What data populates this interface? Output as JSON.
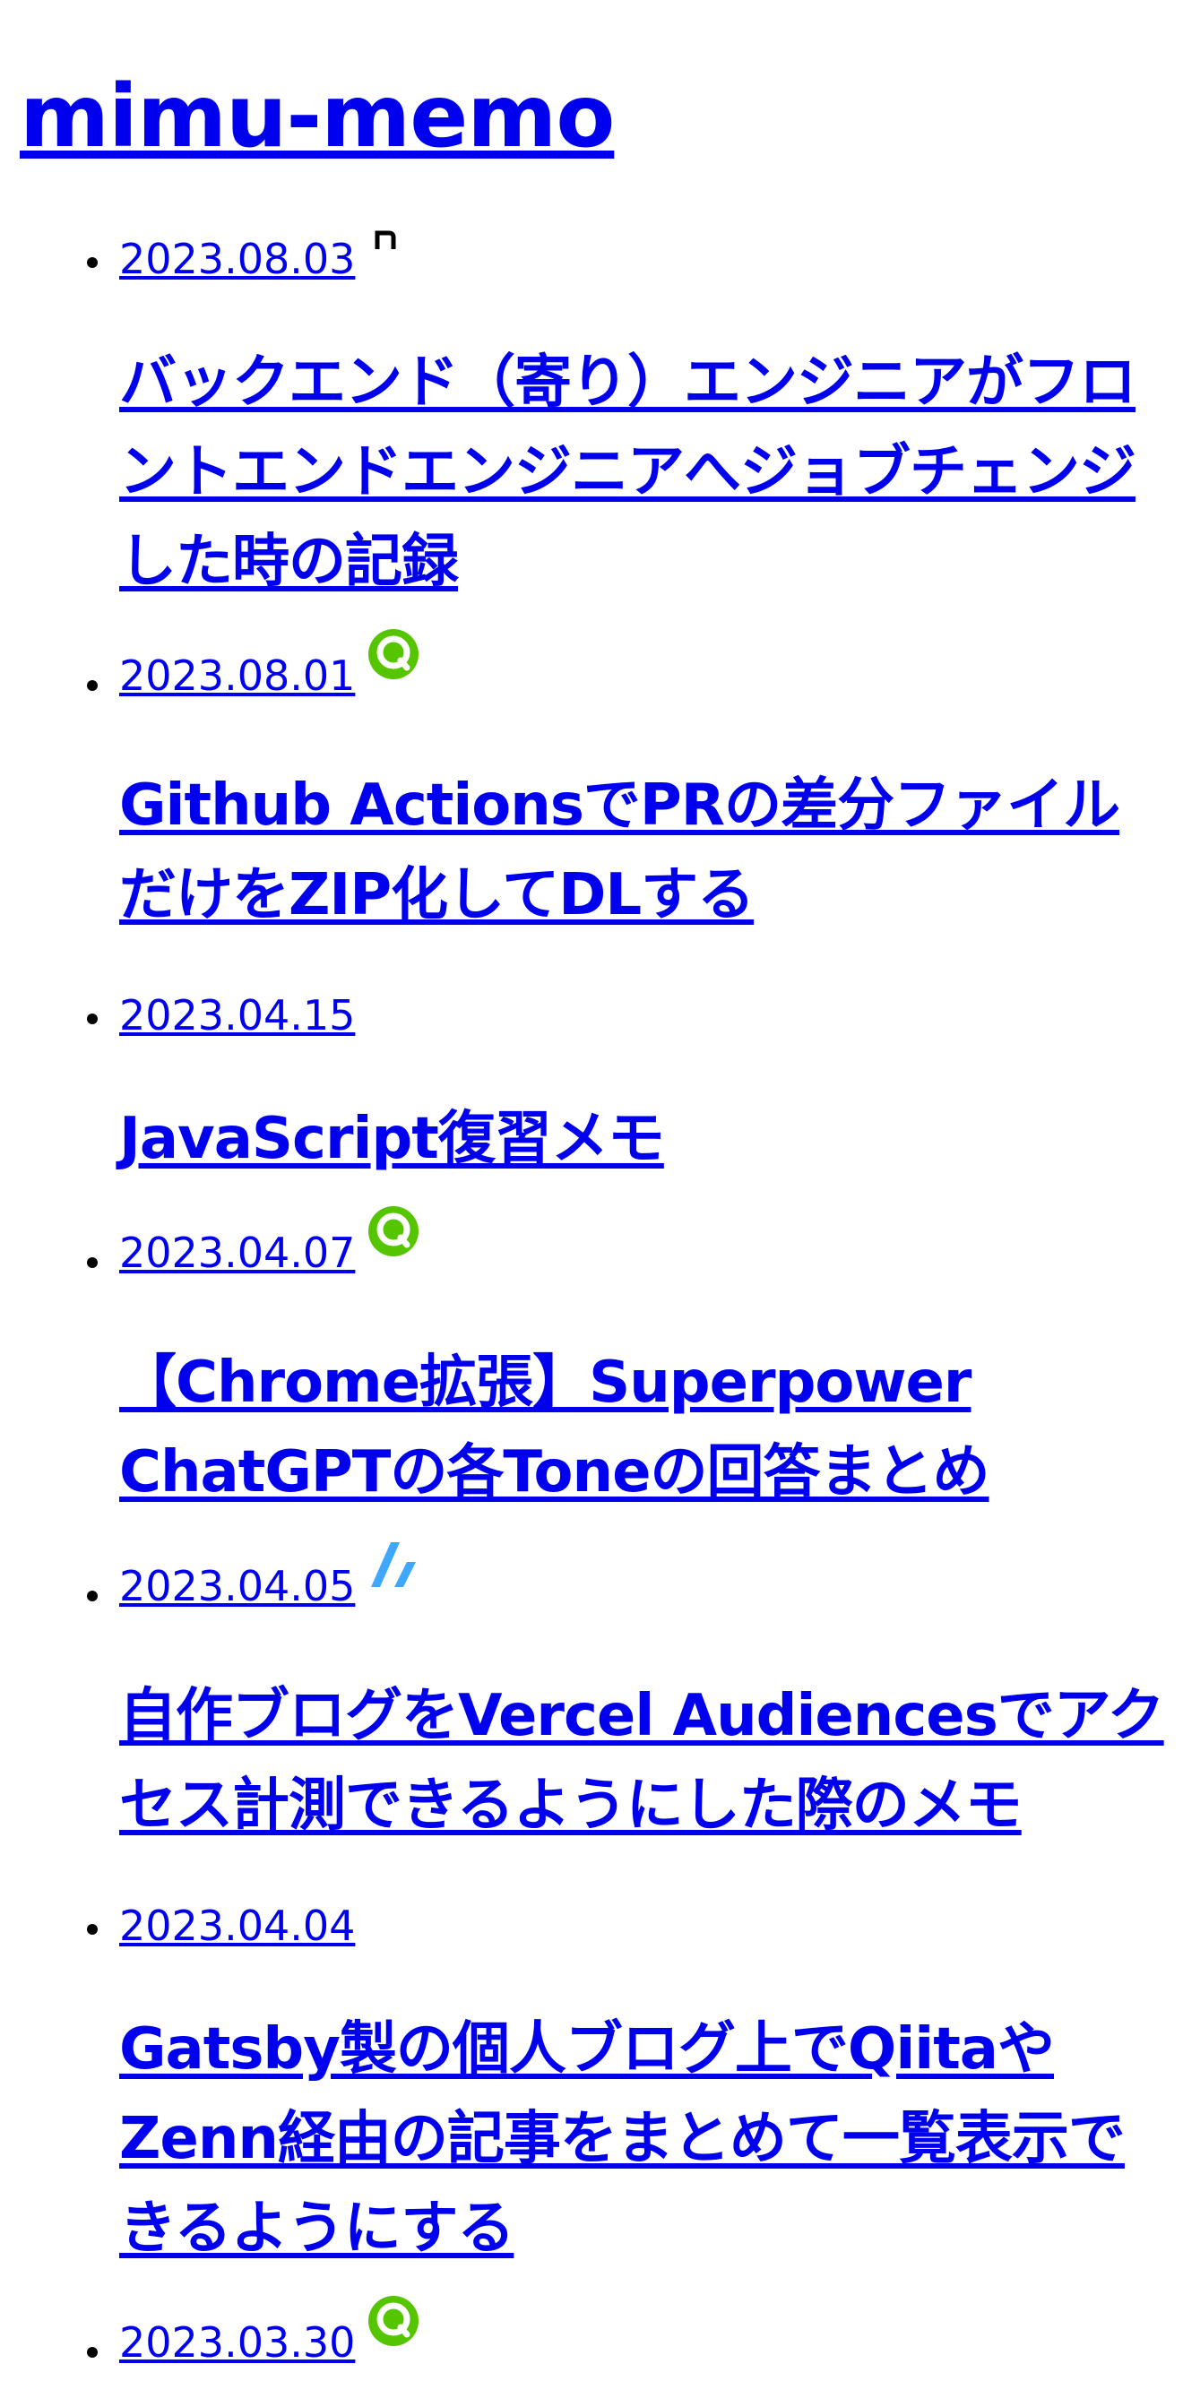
{
  "site": {
    "title": "mimu-memo"
  },
  "posts": [
    {
      "date": "2023.08.03",
      "title": "バックエンド（寄り）エンジニアがフロントエンドエンジニアへジョブチェンジした時の記録",
      "source_icon": "note-icon"
    },
    {
      "date": "2023.08.01",
      "title": "Github ActionsでPRの差分ファイルだけをZIP化してDLする",
      "source_icon": "qiita-icon"
    },
    {
      "date": "2023.04.15",
      "title": "JavaScript復習メモ",
      "source_icon": ""
    },
    {
      "date": "2023.04.07",
      "title": "【Chrome拡張】Superpower ChatGPTの各Toneの回答まとめ",
      "source_icon": "qiita-icon"
    },
    {
      "date": "2023.04.05",
      "title": "自作ブログをVercel Audiencesでアクセス計測できるようにした際のメモ",
      "source_icon": "zenn-icon"
    },
    {
      "date": "2023.04.04",
      "title": "Gatsby製の個人ブログ上でQiitaやZenn経由の記事をまとめて一覧表示できるようにする",
      "source_icon": ""
    },
    {
      "date": "2023.03.30",
      "title": "",
      "source_icon": "qiita-icon"
    }
  ],
  "colors": {
    "link": "#0000ee",
    "qiita": "#55c500",
    "zenn": "#3ea8ff",
    "note": "#000000"
  }
}
